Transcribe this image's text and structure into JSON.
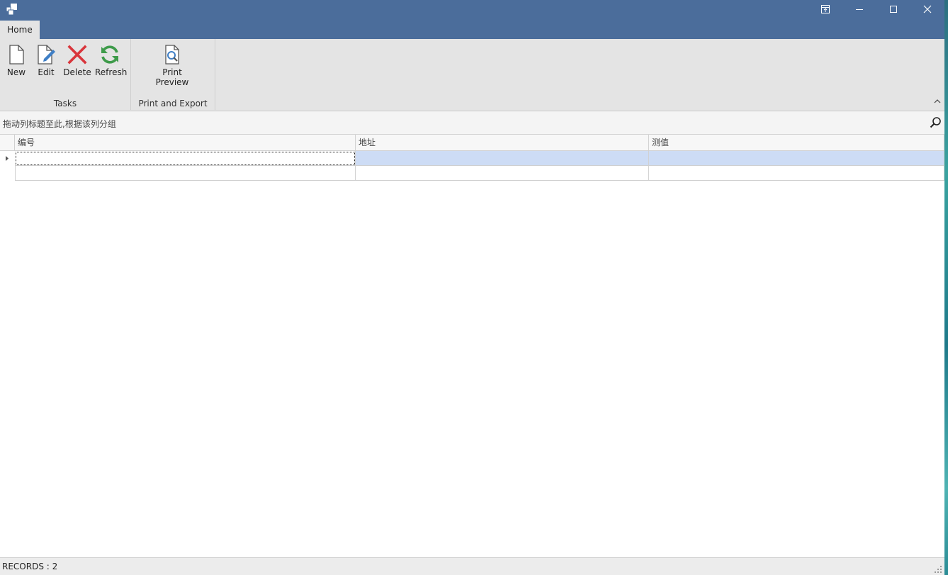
{
  "titlebar": {
    "icons": [
      "app-icon",
      "restore-layout-icon",
      "minimize-icon",
      "maximize-icon",
      "close-icon"
    ]
  },
  "ribbon": {
    "tabs": [
      {
        "label": "Home"
      }
    ],
    "groups": [
      {
        "label": "Tasks",
        "buttons": [
          {
            "label": "New",
            "icon": "new-document-icon"
          },
          {
            "label": "Edit",
            "icon": "edit-document-icon"
          },
          {
            "label": "Delete",
            "icon": "delete-icon"
          },
          {
            "label": "Refresh",
            "icon": "refresh-icon"
          }
        ]
      },
      {
        "label": "Print and Export",
        "buttons": [
          {
            "label_line1": "Print",
            "label_line2": "Preview",
            "icon": "print-preview-icon"
          }
        ]
      }
    ],
    "collapse_icon": "chevron-up-icon"
  },
  "group_panel": {
    "hint": "拖动列标题至此,根据该列分组",
    "find_icon": "search-icon"
  },
  "grid": {
    "columns": [
      {
        "label": "编号"
      },
      {
        "label": "地址"
      },
      {
        "label": "测值"
      }
    ],
    "rows": [
      {
        "cells": [
          "",
          "",
          ""
        ],
        "focused": true
      },
      {
        "cells": [
          "",
          "",
          ""
        ],
        "focused": false
      }
    ]
  },
  "status": {
    "records_text": "RECORDS : 2"
  },
  "colors": {
    "titlebar": "#4b6d9b",
    "ribbon_bg": "#e4e4e4",
    "selection": "#cddcf5",
    "delete_red": "#d9353b",
    "refresh_green": "#3e9b4a",
    "edit_blue": "#3f7fc6"
  }
}
